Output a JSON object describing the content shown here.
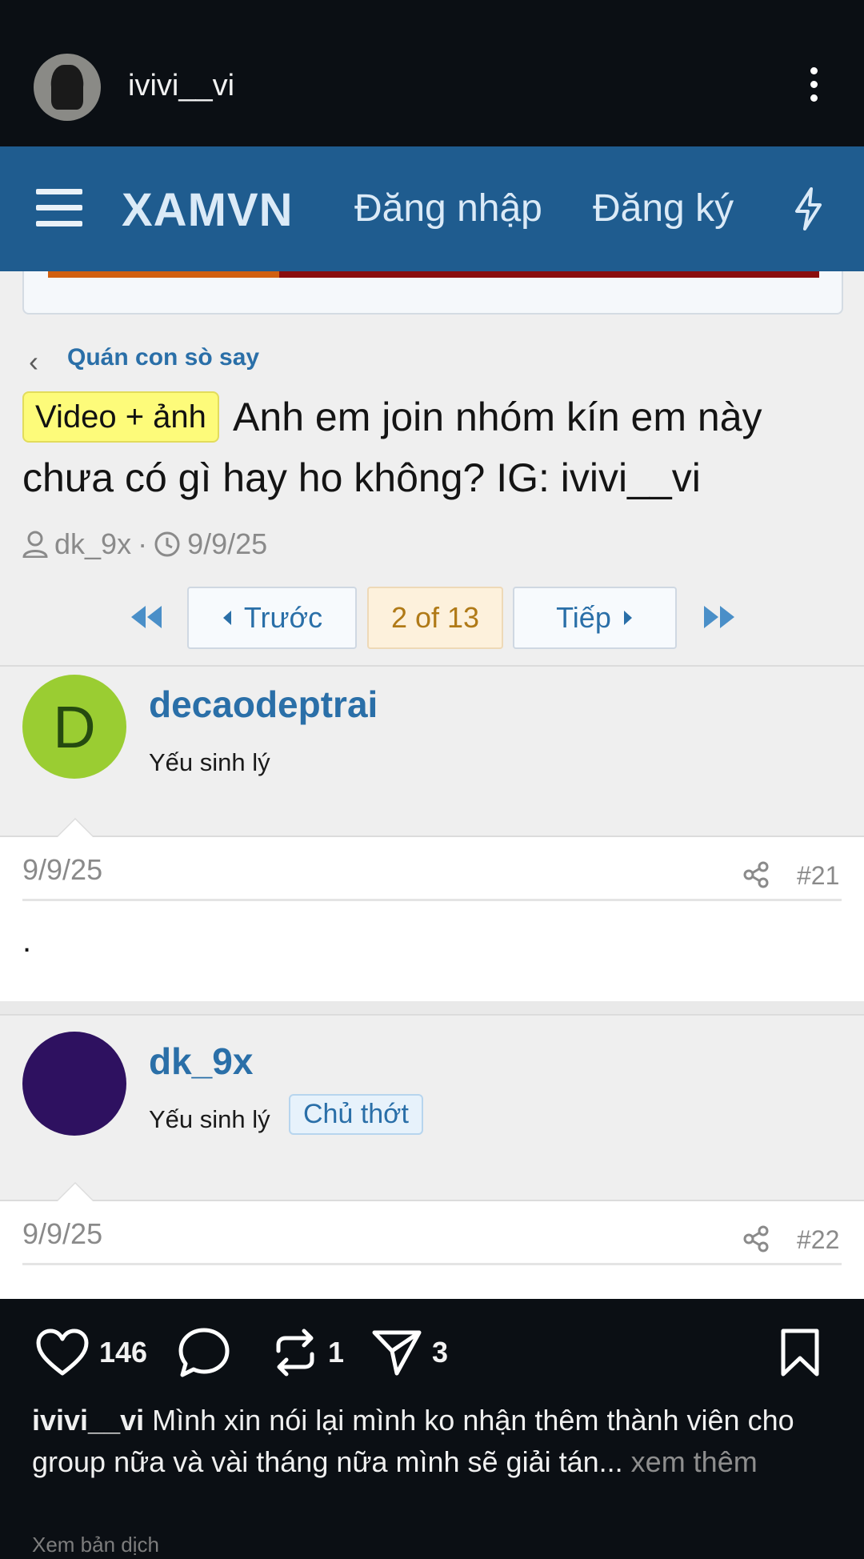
{
  "ig": {
    "username": "ivivi__vi",
    "likes": "146",
    "reposts": "1",
    "shares": "3",
    "caption_user": "ivivi__vi",
    "caption_text": "Mình xin nói lại mình ko nhận thêm thành viên cho group nữa và vài tháng nữa mình sẽ giải tán...",
    "see_more": "xem thêm",
    "translate": "Xem bản dịch"
  },
  "forum": {
    "logo": "XAMVN",
    "login": "Đăng nhập",
    "register": "Đăng ký",
    "breadcrumb": "Quán con sò say",
    "prefix": "Video + ảnh",
    "title": "Anh em join nhóm kín em này chưa có gì hay ho không? IG: ivivi__vi",
    "author": "dk_9x",
    "separator": "·",
    "date": "9/9/25",
    "pagination": {
      "prev": "Trước",
      "current": "2 of 13",
      "next": "Tiếp"
    },
    "posts": [
      {
        "avatar_letter": "D",
        "avatar_color": "#9acd32",
        "username": "decaodeptrai",
        "rank": "Yếu sinh lý",
        "date": "9/9/25",
        "number": "#21",
        "content": "."
      },
      {
        "avatar_letter": "",
        "avatar_color": "#2e1160",
        "username": "dk_9x",
        "rank": "Yếu sinh lý",
        "badge": "Chủ thớt",
        "date": "9/9/25",
        "number": "#22"
      }
    ]
  },
  "colors": {
    "nav_blue": "#1f5c8f",
    "link_blue": "#2a6fa8",
    "prefix_yellow": "#fdfb7a",
    "page_bg": "#0b0f14"
  }
}
